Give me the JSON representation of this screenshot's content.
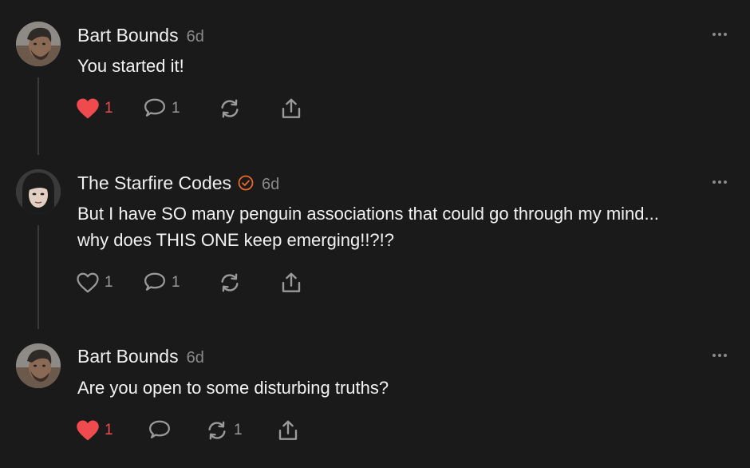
{
  "colors": {
    "background": "#1a1a1b",
    "like": "#ef4b4f",
    "verified": "#e8692c",
    "muted": "#9a9a9a"
  },
  "posts": [
    {
      "author": "Bart Bounds",
      "time": "6d",
      "verified": false,
      "text_lines": [
        "You started it!"
      ],
      "liked": true,
      "likes": "1",
      "replies": "1",
      "reposts": ""
    },
    {
      "author": "The Starfire Codes",
      "time": "6d",
      "verified": true,
      "text_lines": [
        "But I have SO many penguin associations that could go through my mind...",
        "why does THIS ONE keep emerging!!?!?"
      ],
      "liked": false,
      "likes": "1",
      "replies": "1",
      "reposts": ""
    },
    {
      "author": "Bart Bounds",
      "time": "6d",
      "verified": false,
      "text_lines": [
        "Are you open to some disturbing truths?"
      ],
      "liked": true,
      "likes": "1",
      "replies": "",
      "reposts": "1"
    }
  ]
}
